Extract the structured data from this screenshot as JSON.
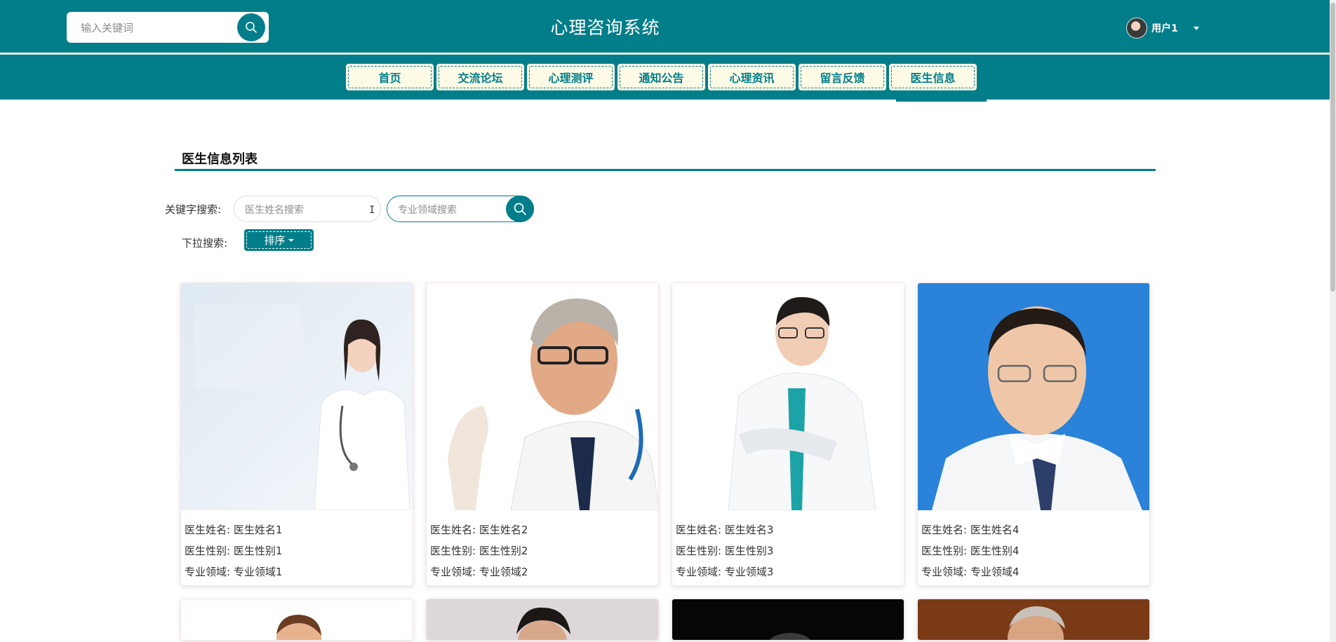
{
  "header": {
    "search_placeholder": "输入关键词",
    "site_title": "心理咨询系统",
    "user_name": "用户1"
  },
  "nav": {
    "items": [
      {
        "label": "首页"
      },
      {
        "label": "交流论坛"
      },
      {
        "label": "心理测评"
      },
      {
        "label": "通知公告"
      },
      {
        "label": "心理资讯"
      },
      {
        "label": "留言反馈"
      },
      {
        "label": "医生信息"
      }
    ],
    "active": "医生信息"
  },
  "section": {
    "title": "医生信息列表"
  },
  "filters": {
    "keyword_label": "关键字搜索:",
    "name_placeholder": "医生姓名搜索",
    "area_placeholder": "专业领域搜索",
    "dropdown_label": "下拉搜索:",
    "sort_label": "排序"
  },
  "cards": [
    {
      "name": "医生姓名: 医生姓名1",
      "gender": "医生性别: 医生性别1",
      "area": "专业领域: 专业领域1"
    },
    {
      "name": "医生姓名: 医生姓名2",
      "gender": "医生性别: 医生性别2",
      "area": "专业领域: 专业领域2"
    },
    {
      "name": "医生姓名: 医生姓名3",
      "gender": "医生性别: 医生性别3",
      "area": "专业领域: 专业领域3"
    },
    {
      "name": "医生姓名: 医生姓名4",
      "gender": "医生性别: 医生性别4",
      "area": "专业领域: 专业领域4"
    }
  ],
  "colors": {
    "brand": "#017e8a",
    "nav_bg": "#fdfbe6"
  }
}
